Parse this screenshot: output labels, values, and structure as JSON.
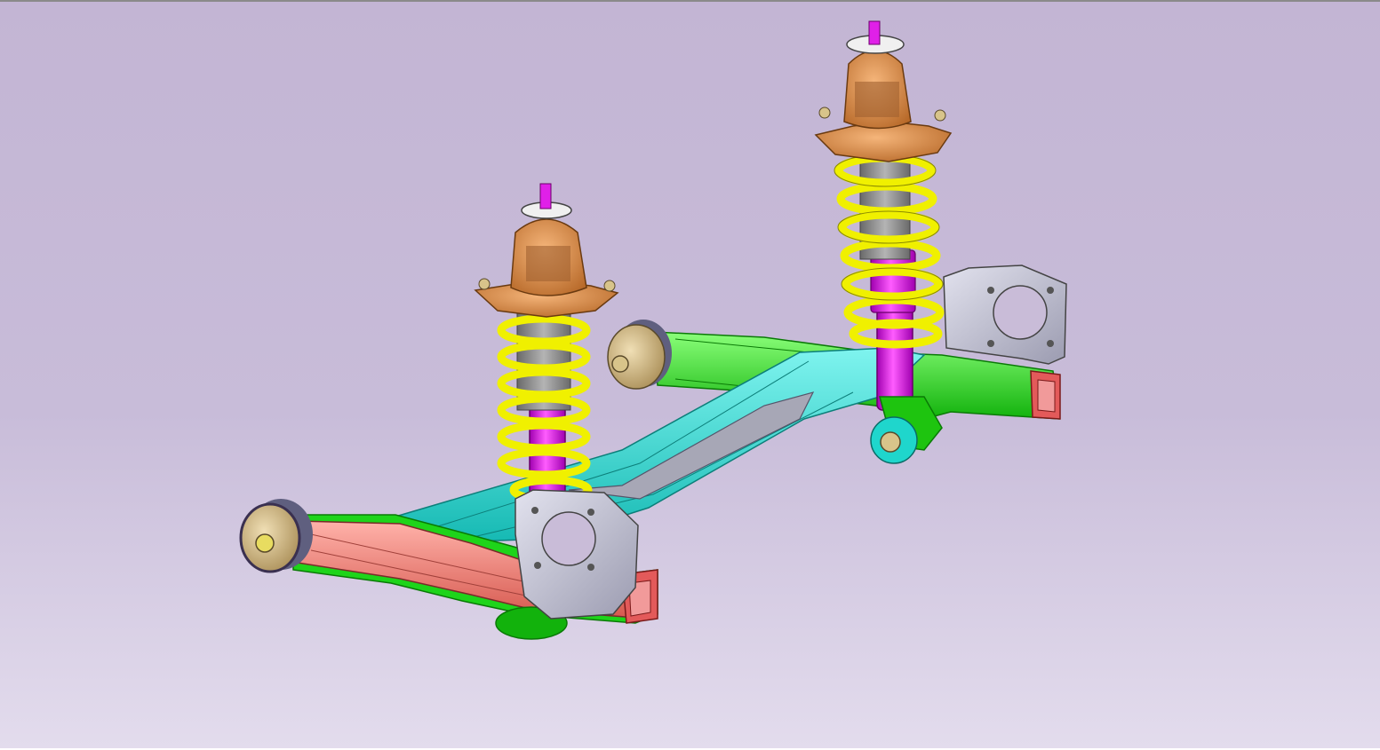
{
  "viewport": {
    "background_top": "#c3b5d4",
    "background_bottom": "#e3dced"
  },
  "model": {
    "colors": {
      "coil_spring": "#f0f000",
      "damper_body": "#e020e8",
      "damper_rod": "#8a8a8a",
      "strut_mount": "#d58a45",
      "torsion_beam": "#27e0d8",
      "trailing_arm_right": "#18e010",
      "trailing_arm_left": "#f07a70",
      "bushing": "#d2b98a",
      "spindle_bracket": "#b8b8c8",
      "hardware": "#8a7cc0"
    }
  }
}
